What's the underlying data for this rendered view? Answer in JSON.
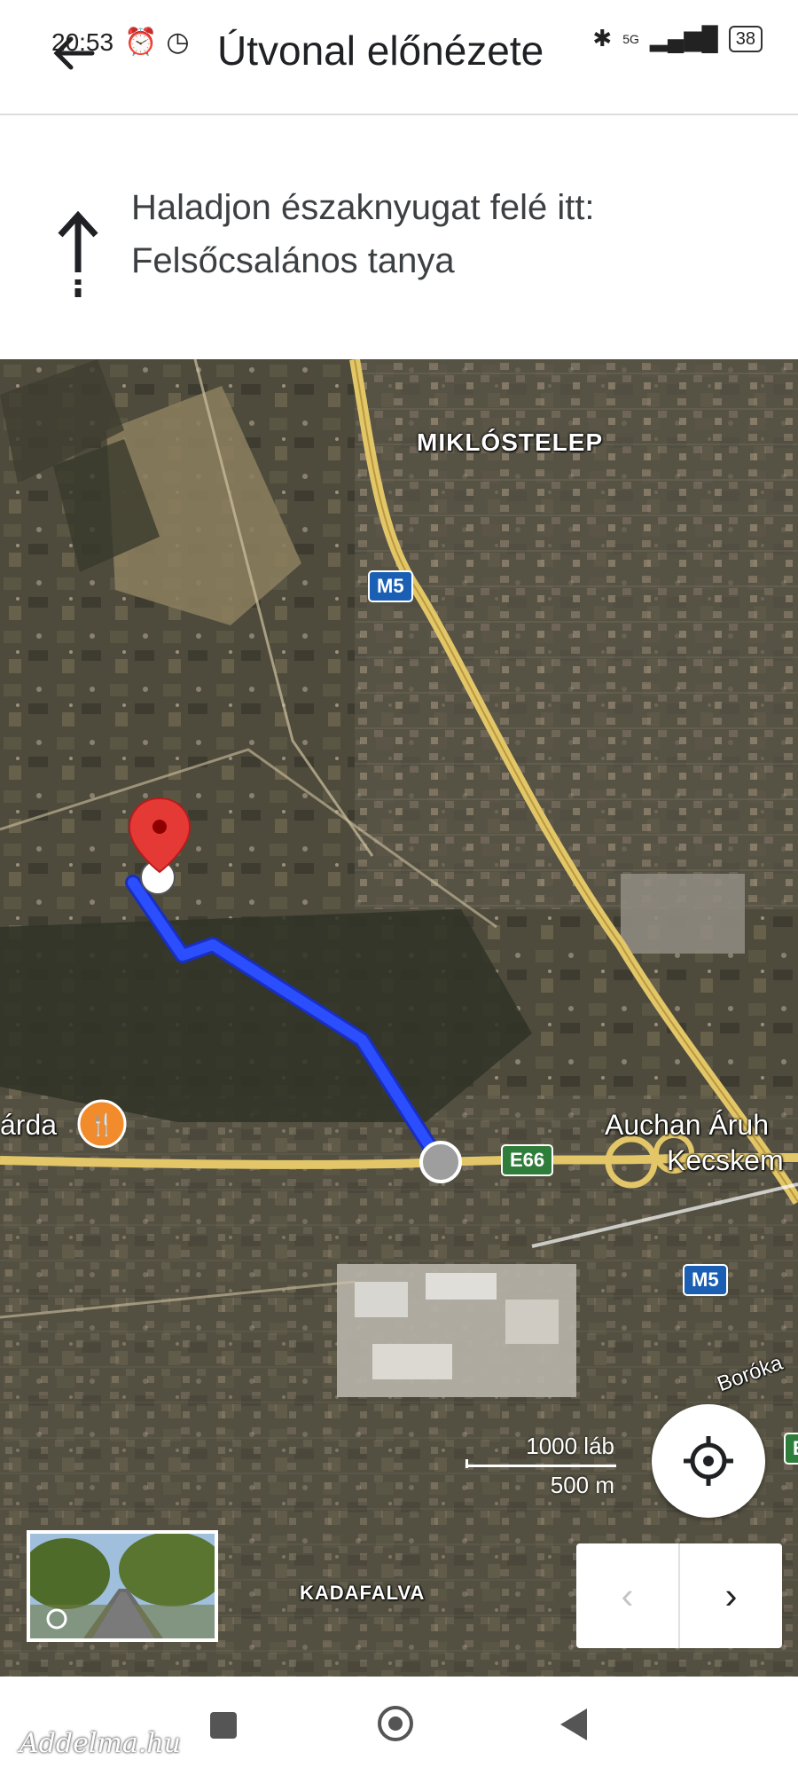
{
  "status_bar": {
    "time": "20:53",
    "network": "5G",
    "battery": "38"
  },
  "header": {
    "title": "Útvonal előnézete"
  },
  "instruction": {
    "icon": "straight-arrow-icon",
    "line1": "Haladjon északnyugat felé itt:",
    "line2": "Felsőcsalános tanya"
  },
  "map": {
    "labels": {
      "district_north": "MIKLÓSTELEP",
      "district_south": "KADAFALVA",
      "poi_restaurant": "árda",
      "poi_shop_line1": "Auchan Áruh",
      "poi_shop_line2": "Kecskem",
      "street": "Borókа"
    },
    "shields": {
      "m5_top": "M5",
      "m5_bottom": "M5",
      "e66": "E66",
      "edge": "E"
    },
    "scale": {
      "imperial": "1000 láb",
      "metric": "500 m"
    },
    "colors": {
      "route": "#2b4fff",
      "destination_pin": "#e53935",
      "motorway": "#e2c668"
    }
  },
  "nav_controls": {
    "prev": "‹",
    "next": "›"
  },
  "watermark": "Addelma.hu"
}
